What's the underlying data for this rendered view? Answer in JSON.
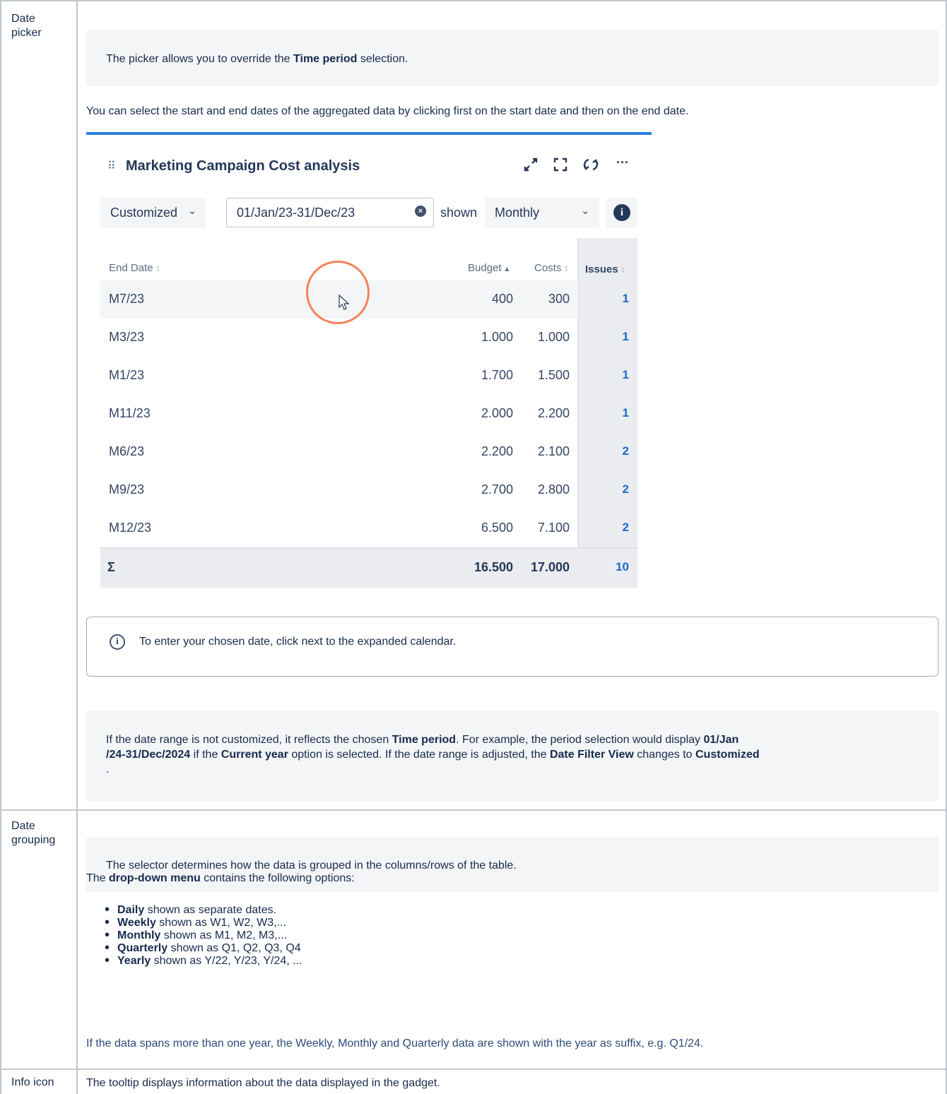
{
  "rows": {
    "date_picker": {
      "label": "Date picker",
      "panel_pre": "The picker allows you to override the ",
      "panel_bold": "Time period",
      "panel_post": " selection.",
      "instruction": "You can select the start and end dates of the aggregated data by clicking first on the start date and then on the end date.",
      "gadget": {
        "title": "Marketing Campaign Cost analysis",
        "view_select": "Customized",
        "date_range": "01/Jan/23-31/Dec/23",
        "shown_label": "shown",
        "grouping_select": "Monthly",
        "info_glyph": "i",
        "columns": {
          "end_date": "End Date",
          "budget": "Budget",
          "costs": "Costs",
          "issues": "Issues"
        },
        "table_rows": [
          {
            "end_date": "M7/23",
            "budget": "400",
            "costs": "300",
            "issues": "1"
          },
          {
            "end_date": "M3/23",
            "budget": "1.000",
            "costs": "1.000",
            "issues": "1"
          },
          {
            "end_date": "M1/23",
            "budget": "1.700",
            "costs": "1.500",
            "issues": "1"
          },
          {
            "end_date": "M11/23",
            "budget": "2.000",
            "costs": "2.200",
            "issues": "1"
          },
          {
            "end_date": "M6/23",
            "budget": "2.200",
            "costs": "2.100",
            "issues": "2"
          },
          {
            "end_date": "M9/23",
            "budget": "2.700",
            "costs": "2.800",
            "issues": "2"
          },
          {
            "end_date": "M12/23",
            "budget": "6.500",
            "costs": "7.100",
            "issues": "2"
          }
        ],
        "totals": {
          "label": "Σ",
          "budget": "16.500",
          "costs": "17.000",
          "issues": "10"
        }
      },
      "callout": "To enter your chosen date, click next to the expanded calendar.",
      "note": {
        "p1": "If the date range is not customized, it reflects the chosen ",
        "b1": "Time period",
        "p2": ". For example, the period selection would display ",
        "b2": "01/Jan",
        "b3": "/24-31/Dec/2024",
        "p3": " if the ",
        "b4": "Current year",
        "p4": " option is selected. If the date range is adjusted, the ",
        "b5": "Date Filter View",
        "p5": " changes to ",
        "b6": "Customized",
        "p6": "."
      }
    },
    "date_grouping": {
      "label": "Date grouping",
      "panel_text": "The selector determines how the data is grouped in the columns/rows of the table.",
      "intro_pre": "The ",
      "intro_bold": "drop-down menu",
      "intro_post": " contains the following options:",
      "options": [
        {
          "bold": "Daily",
          "rest": " shown as separate dates."
        },
        {
          "bold": "Weekly",
          "rest": " shown as W1, W2, W3,..."
        },
        {
          "bold": "Monthly",
          "rest": " shown as M1, M2, M3,..."
        },
        {
          "bold": "Quarterly",
          "rest": " shown as Q1, Q2, Q3, Q4"
        },
        {
          "bold": "Yearly",
          "rest": " shown as Y/22, Y/23, Y/24, ..."
        }
      ],
      "suffix_note": "If the data spans more than one year, the Weekly, Monthly and Quarterly data are shown with the year as suffix, e.g. Q1/24."
    },
    "info_icon": {
      "label": "Info icon",
      "text": "The tooltip displays information about the data displayed in the gadget."
    }
  }
}
